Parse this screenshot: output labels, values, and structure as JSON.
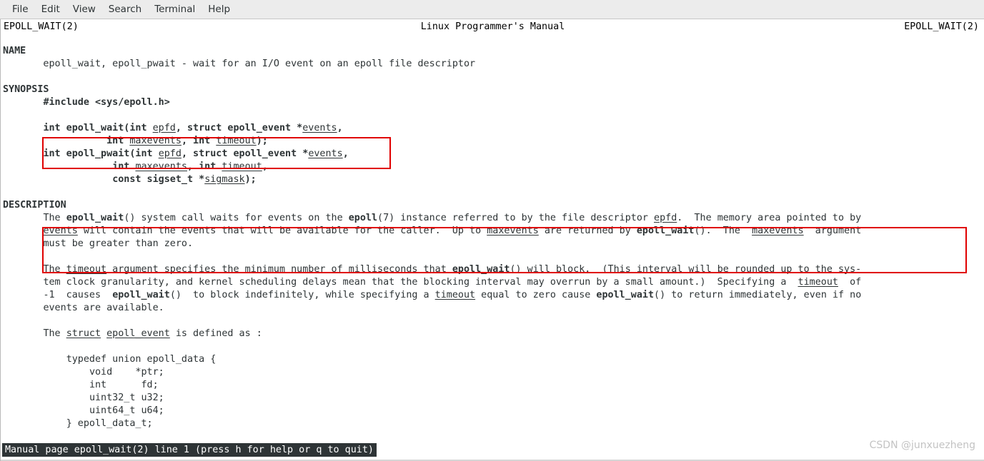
{
  "window": {
    "menu": [
      {
        "label": "File"
      },
      {
        "label": "Edit"
      },
      {
        "label": "View"
      },
      {
        "label": "Search"
      },
      {
        "label": "Terminal"
      },
      {
        "label": "Help"
      }
    ]
  },
  "manpage": {
    "header_left": "EPOLL_WAIT(2)",
    "header_center": "Linux Programmer's Manual",
    "header_right": "EPOLL_WAIT(2)",
    "sections": {
      "name_heading": "NAME",
      "name_body": "       epoll_wait, epoll_pwait - wait for an I/O event on an epoll file descriptor",
      "synopsis_heading": "SYNOPSIS",
      "synopsis_include": "       #include <sys/epoll.h>",
      "synopsis_lines": [
        {
          "indent": "       ",
          "parts": [
            {
              "t": "int epoll_wait(int ",
              "s": "b"
            },
            {
              "t": "epfd",
              "s": "u"
            },
            {
              "t": ", struct epoll_event *",
              "s": "b"
            },
            {
              "t": "events",
              "s": "u"
            },
            {
              "t": ",",
              "s": "b"
            }
          ]
        },
        {
          "indent": "                  ",
          "parts": [
            {
              "t": "int ",
              "s": "b"
            },
            {
              "t": "maxevents",
              "s": "u"
            },
            {
              "t": ", int ",
              "s": "b"
            },
            {
              "t": "timeout",
              "s": "u"
            },
            {
              "t": ");",
              "s": "b"
            }
          ]
        },
        {
          "indent": "       ",
          "parts": [
            {
              "t": "int epoll_pwait(int ",
              "s": "b"
            },
            {
              "t": "epfd",
              "s": "u"
            },
            {
              "t": ", struct epoll_event *",
              "s": "b"
            },
            {
              "t": "events",
              "s": "u"
            },
            {
              "t": ",",
              "s": "b"
            }
          ]
        },
        {
          "indent": "                   ",
          "parts": [
            {
              "t": "int ",
              "s": "b"
            },
            {
              "t": "maxevents",
              "s": "u"
            },
            {
              "t": ", int ",
              "s": "b"
            },
            {
              "t": "timeout",
              "s": "u"
            },
            {
              "t": ",",
              "s": "b"
            }
          ]
        },
        {
          "indent": "                   ",
          "parts": [
            {
              "t": "const sigset_t *",
              "s": "b"
            },
            {
              "t": "sigmask",
              "s": "u"
            },
            {
              "t": ");",
              "s": "b"
            }
          ]
        }
      ],
      "description_heading": "DESCRIPTION",
      "description_lines": [
        {
          "indent": "       ",
          "parts": [
            {
              "t": "The "
            },
            {
              "t": "epoll_wait",
              "s": "b"
            },
            {
              "t": "() system call waits for events on the "
            },
            {
              "t": "epoll",
              "s": "b"
            },
            {
              "t": "(7) instance referred to by the file descriptor "
            },
            {
              "t": "epfd",
              "s": "u"
            },
            {
              "t": ".  The memory area pointed to by"
            }
          ]
        },
        {
          "indent": "       ",
          "parts": [
            {
              "t": "events",
              "s": "u"
            },
            {
              "t": " will contain the events that will be available for the caller.  Up to "
            },
            {
              "t": "maxevents",
              "s": "u"
            },
            {
              "t": " are returned by "
            },
            {
              "t": "epoll_wait",
              "s": "b"
            },
            {
              "t": "().  The  "
            },
            {
              "t": "maxevents",
              "s": "u"
            },
            {
              "t": "  argument"
            }
          ]
        },
        {
          "indent": "       ",
          "parts": [
            {
              "t": "must be greater than zero."
            }
          ]
        },
        {
          "blank": true
        },
        {
          "indent": "       ",
          "parts": [
            {
              "t": "The "
            },
            {
              "t": "timeout",
              "s": "u"
            },
            {
              "t": " argument specifies the minimum number of milliseconds that "
            },
            {
              "t": "epoll_wait",
              "s": "b"
            },
            {
              "t": "() will block.  (This interval will be rounded up to the sys-"
            }
          ]
        },
        {
          "indent": "       ",
          "parts": [
            {
              "t": "tem clock granularity, and kernel scheduling delays mean that the blocking interval may overrun by a small amount.)  Specifying a  "
            },
            {
              "t": "timeout",
              "s": "u"
            },
            {
              "t": "  of"
            }
          ]
        },
        {
          "indent": "       ",
          "parts": [
            {
              "t": "-1  causes  "
            },
            {
              "t": "epoll_wait",
              "s": "b"
            },
            {
              "t": "()  to block indefinitely, while specifying a "
            },
            {
              "t": "timeout",
              "s": "u"
            },
            {
              "t": " equal to zero cause "
            },
            {
              "t": "epoll_wait",
              "s": "b"
            },
            {
              "t": "() to return immediately, even if no"
            }
          ]
        },
        {
          "indent": "       ",
          "parts": [
            {
              "t": "events are available."
            }
          ]
        },
        {
          "blank": true
        },
        {
          "indent": "       ",
          "parts": [
            {
              "t": "The "
            },
            {
              "t": "struct",
              "s": "u"
            },
            {
              "t": " "
            },
            {
              "t": "epoll_event",
              "s": "u"
            },
            {
              "t": " is defined as :"
            }
          ]
        },
        {
          "blank": true
        },
        {
          "indent": "           ",
          "parts": [
            {
              "t": "typedef union epoll_data {"
            }
          ]
        },
        {
          "indent": "               ",
          "parts": [
            {
              "t": "void    *ptr;"
            }
          ]
        },
        {
          "indent": "               ",
          "parts": [
            {
              "t": "int      fd;"
            }
          ]
        },
        {
          "indent": "               ",
          "parts": [
            {
              "t": "uint32_t u32;"
            }
          ]
        },
        {
          "indent": "               ",
          "parts": [
            {
              "t": "uint64_t u64;"
            }
          ]
        },
        {
          "indent": "           ",
          "parts": [
            {
              "t": "} epoll_data_t;"
            }
          ]
        }
      ]
    }
  },
  "status_bar": {
    "text": "Manual page epoll_wait(2) line 1 (press h for help or q to quit)"
  },
  "watermark": {
    "text": "CSDN @junxuezheng"
  },
  "annotations": {
    "highlight_color": "#e00000",
    "boxes": [
      {
        "name": "synopsis-epoll-wait-signature"
      },
      {
        "name": "description-first-paragraph"
      }
    ]
  }
}
